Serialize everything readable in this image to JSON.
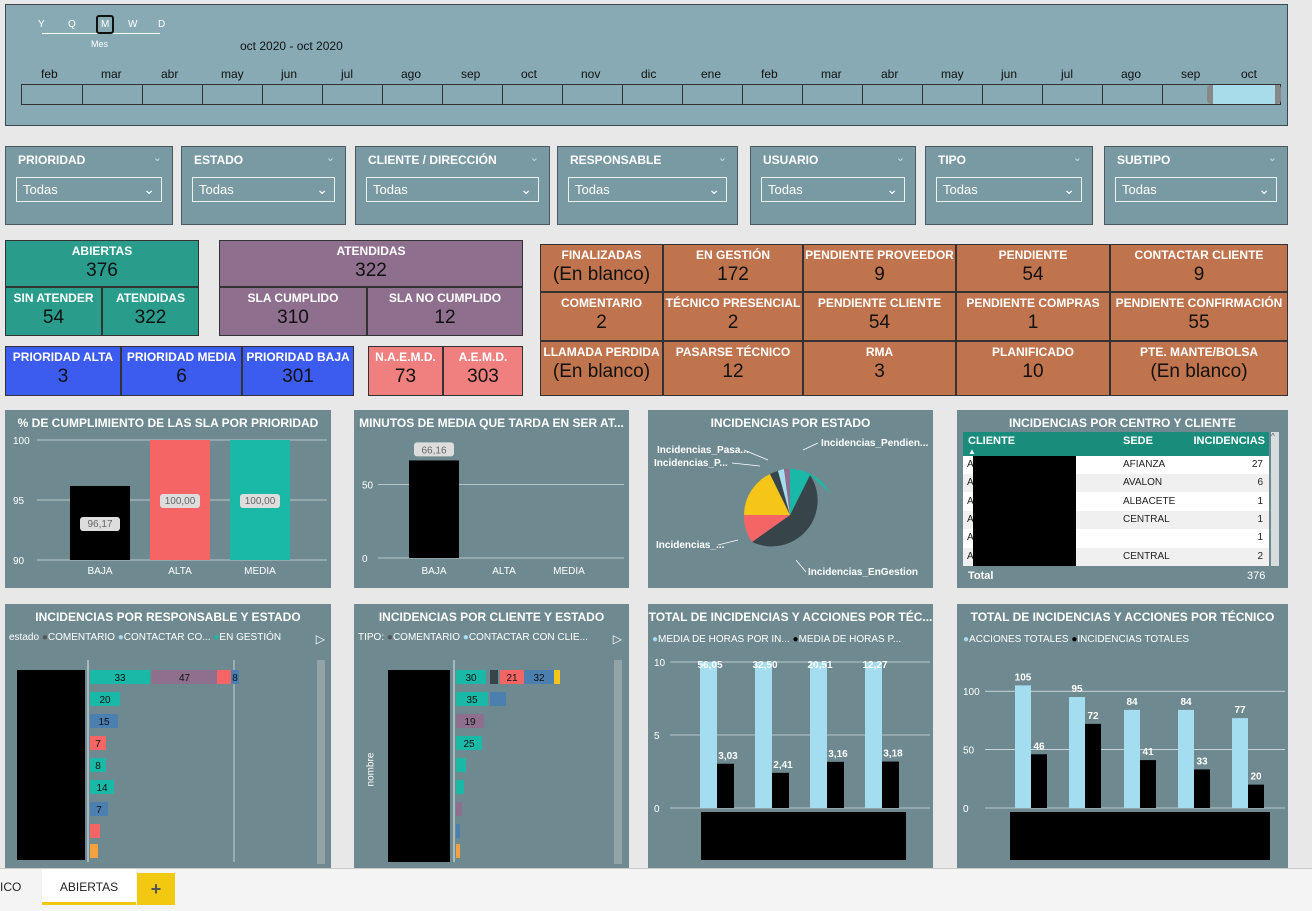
{
  "timeline": {
    "periods": [
      "Y",
      "Q",
      "M",
      "W",
      "D"
    ],
    "selected_period_label": "Mes",
    "range_label": "oct 2020 - oct 2020",
    "months": [
      "feb",
      "mar",
      "abr",
      "may",
      "jun",
      "jul",
      "ago",
      "sep",
      "oct",
      "nov",
      "dic",
      "ene",
      "feb",
      "mar",
      "abr",
      "may",
      "jun",
      "jul",
      "ago",
      "sep",
      "oct"
    ]
  },
  "filters": [
    {
      "title": "PRIORIDAD",
      "value": "Todas"
    },
    {
      "title": "ESTADO",
      "value": "Todas"
    },
    {
      "title": "CLIENTE / DIRECCIÓN",
      "value": "Todas"
    },
    {
      "title": "RESPONSABLE",
      "value": "Todas"
    },
    {
      "title": "USUARIO",
      "value": "Todas"
    },
    {
      "title": "TIPO",
      "value": "Todas"
    },
    {
      "title": "SUBTIPO",
      "value": "Todas"
    }
  ],
  "kpi": {
    "abiertas": {
      "label": "ABIERTAS",
      "value": "376"
    },
    "sin_atender": {
      "label": "SIN ATENDER",
      "value": "54"
    },
    "atendidas_small": {
      "label": "ATENDIDAS",
      "value": "322"
    },
    "atendidas": {
      "label": "ATENDIDAS",
      "value": "322"
    },
    "sla_cumplido": {
      "label": "SLA CUMPLIDO",
      "value": "310"
    },
    "sla_no_cumplido": {
      "label": "SLA NO CUMPLIDO",
      "value": "12"
    },
    "prioridad_alta": {
      "label": "PRIORIDAD ALTA",
      "value": "3"
    },
    "prioridad_media": {
      "label": "PRIORIDAD MEDIA",
      "value": "6"
    },
    "prioridad_baja": {
      "label": "PRIORIDAD BAJA",
      "value": "301"
    },
    "naemd": {
      "label": "N.A.E.M.D.",
      "value": "73"
    },
    "aemd": {
      "label": "A.E.M.D.",
      "value": "303"
    },
    "estados": [
      {
        "label": "FINALIZADAS",
        "value": "(En blanco)"
      },
      {
        "label": "EN GESTIÓN",
        "value": "172"
      },
      {
        "label": "PENDIENTE PROVEEDOR",
        "value": "9"
      },
      {
        "label": "PENDIENTE",
        "value": "54"
      },
      {
        "label": "CONTACTAR CLIENTE",
        "value": "9"
      },
      {
        "label": "COMENTARIO",
        "value": "2"
      },
      {
        "label": "TÉCNICO PRESENCIAL",
        "value": "2"
      },
      {
        "label": "PENDIENTE CLIENTE",
        "value": "54"
      },
      {
        "label": "PENDIENTE COMPRAS",
        "value": "1"
      },
      {
        "label": "PENDIENTE CONFIRMACIÓN",
        "value": "55"
      },
      {
        "label": "LLAMADA PERDIDA",
        "value": "(En blanco)"
      },
      {
        "label": "PASARSE TÉCNICO",
        "value": "12"
      },
      {
        "label": "RMA",
        "value": "3"
      },
      {
        "label": "PLANIFICADO",
        "value": "10"
      },
      {
        "label": "PTE. MANTE/BOLSA",
        "value": "(En blanco)"
      }
    ]
  },
  "sla_chart": {
    "title": "% DE CUMPLIMIENTO DE LAS SLA POR PRIORIDAD",
    "y_ticks": [
      "100",
      "95",
      "90"
    ],
    "bars": [
      {
        "label": "BAJA",
        "value": 96.17,
        "value_text": "96,17",
        "color": "#000000"
      },
      {
        "label": "ALTA",
        "value": 100,
        "value_text": "100,00",
        "color": "#f56565"
      },
      {
        "label": "MEDIA",
        "value": 100,
        "value_text": "100,00",
        "color": "#1ab8a6"
      }
    ],
    "ylim": [
      90,
      100
    ]
  },
  "minutos_chart": {
    "title": "MINUTOS DE MEDIA QUE TARDA EN SER AT...",
    "y_ticks": [
      "50",
      "0"
    ],
    "bars": [
      {
        "label": "BAJA",
        "value": 66.16,
        "value_text": "66,16"
      },
      {
        "label": "ALTA",
        "value": 0,
        "value_text": ""
      },
      {
        "label": "MEDIA",
        "value": 0,
        "value_text": ""
      }
    ],
    "ylim": [
      0,
      80
    ]
  },
  "estado_pie": {
    "title": "INCIDENCIAS POR ESTADO",
    "labels": [
      "Incidencias_Pasa...",
      "Incidencias_P...",
      "Incidencias_Pendien...",
      "Incidencias_...",
      "Incidencias_EnGestion"
    ]
  },
  "centro_table": {
    "title": "INCIDENCIAS POR CENTRO Y CLIENTE",
    "headers": [
      "CLIENTE",
      "SEDE",
      "INCIDENCIAS"
    ],
    "rows": [
      {
        "cliente": "A",
        "sede": "AFIANZA",
        "incidencias": "27"
      },
      {
        "cliente": "A",
        "sede": "AVALON",
        "incidencias": "6"
      },
      {
        "cliente": "A",
        "sede": "ALBACETE",
        "incidencias": "1"
      },
      {
        "cliente": "A",
        "sede": "CENTRAL",
        "incidencias": "1"
      },
      {
        "cliente": "A",
        "sede": "",
        "incidencias": "1"
      },
      {
        "cliente": "A",
        "sede": "CENTRAL",
        "incidencias": "2"
      }
    ],
    "total_label": "Total",
    "total_value": "376"
  },
  "responsable_chart": {
    "title": "INCIDENCIAS POR RESPONSABLE Y ESTADO",
    "legend_prefix": "estado",
    "legend": [
      "COMENTARIO",
      "CONTACTAR CO...",
      "EN GESTIÓN"
    ],
    "values": [
      "33",
      "47",
      "8",
      "20",
      "15",
      "7",
      "8",
      "14",
      "7"
    ]
  },
  "cliente_chart": {
    "title": "INCIDENCIAS POR CLIENTE Y ESTADO",
    "legend_prefix": "TIPO:",
    "legend": [
      "COMENTARIO",
      "CONTACTAR CON CLIE..."
    ],
    "values": [
      "30",
      "21",
      "32",
      "35",
      "19",
      "25"
    ],
    "axis_label": "nombre"
  },
  "horas_chart": {
    "title": "TOTAL DE INCIDENCIAS Y ACCIONES POR TÉC...",
    "legend": [
      "MEDIA DE HORAS POR IN...",
      "MEDIA DE HORAS P..."
    ],
    "y_ticks": [
      "10",
      "5",
      "0"
    ],
    "ylim": [
      0,
      10
    ],
    "series": [
      {
        "name": "MEDIA DE HORAS POR IN...",
        "values": [
          56.05,
          32.5,
          20.51,
          12.27
        ],
        "labels": [
          "56,05",
          "32,50",
          "20,51",
          "12,27"
        ],
        "color": "#a4dcf0"
      },
      {
        "name": "MEDIA DE HORAS P...",
        "values": [
          3.03,
          2.41,
          3.16,
          3.18
        ],
        "labels": [
          "3,03",
          "2,41",
          "3,16",
          "3,18"
        ],
        "color": "#000000"
      }
    ]
  },
  "acciones_chart": {
    "title": "TOTAL DE INCIDENCIAS Y ACCIONES POR TÉCNICO",
    "legend": [
      "ACCIONES TOTALES",
      "INCIDENCIAS TOTALES"
    ],
    "y_ticks": [
      "100",
      "50",
      "0"
    ],
    "ylim": [
      0,
      125
    ],
    "series": [
      {
        "name": "ACCIONES TOTALES",
        "values": [
          105,
          95,
          84,
          84,
          77
        ],
        "color": "#a4dcf0"
      },
      {
        "name": "INCIDENCIAS TOTALES",
        "values": [
          46,
          72,
          41,
          33,
          20
        ],
        "color": "#000000"
      }
    ]
  },
  "tabs": {
    "partial": "ICO",
    "active": "ABIERTAS",
    "add": "+"
  },
  "colors": {
    "panel": "#7a9aa3",
    "card": "#6e8a90",
    "teal": "#2a9c8c",
    "purple": "#8e6f8e",
    "blue": "#3c5cf0",
    "salmon": "#f08080",
    "orange": "#c0744e"
  }
}
